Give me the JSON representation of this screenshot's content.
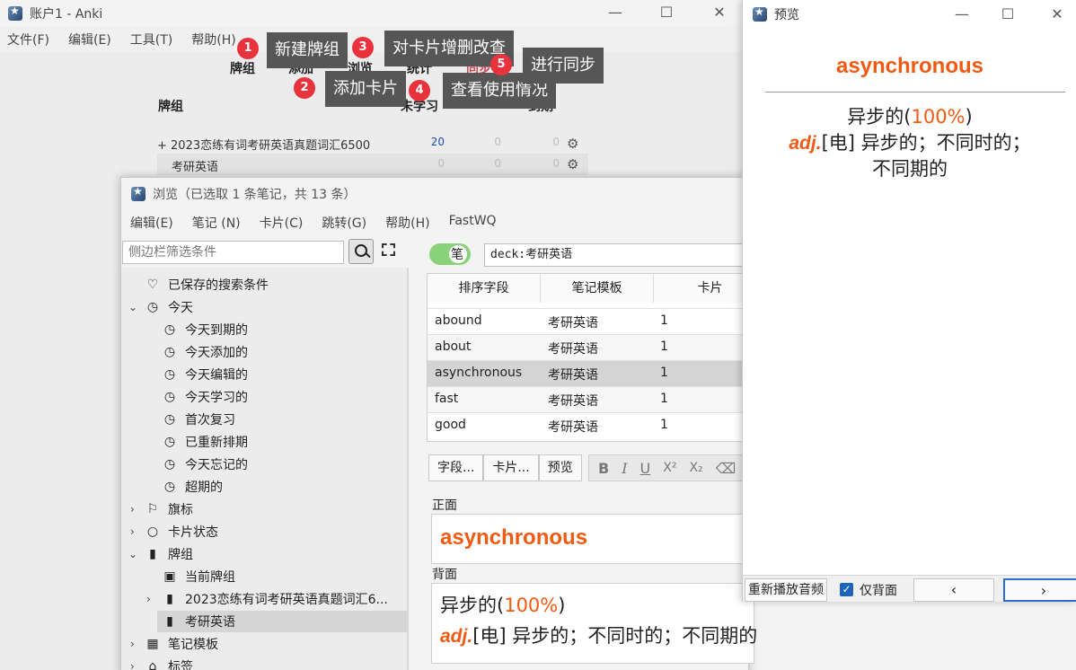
{
  "main": {
    "title": "账户1 - Anki",
    "menu": [
      "文件(F)",
      "编辑(E)",
      "工具(T)",
      "帮助(H)"
    ],
    "toolbar": {
      "decks": "牌组",
      "add": "添加",
      "browse": "浏览",
      "stats": "统计",
      "sync": "同步"
    },
    "deck_list": {
      "col_deck": "牌组",
      "col_new": "未学习",
      "col_due": "到期",
      "rows": [
        {
          "name": "+ 2023恋练有词考研英语真题词汇6500",
          "new": "20",
          "learn": "0",
          "due": "0"
        },
        {
          "name": "考研英语",
          "new": "0",
          "learn": "0",
          "due": "0"
        }
      ]
    }
  },
  "callouts": [
    {
      "num": "1",
      "text": "新建牌组"
    },
    {
      "num": "2",
      "text": "添加卡片"
    },
    {
      "num": "3",
      "text": "对卡片增删改查"
    },
    {
      "num": "4",
      "text": "查看使用情况"
    },
    {
      "num": "5",
      "text": "进行同步"
    }
  ],
  "browse": {
    "title": "浏览（已选取 1 条笔记，共 13 条）",
    "menu": [
      "编辑(E)",
      "笔记 (N)",
      "卡片(C)",
      "跳转(G)",
      "帮助(H)",
      "FastWQ"
    ],
    "sidebar_placeholder": "侧边栏筛选条件",
    "toggle_label": "笔",
    "query": "deck:考研英语",
    "tree": {
      "saved": "已保存的搜索条件",
      "today": "今天",
      "today_due": "今天到期的",
      "today_added": "今天添加的",
      "today_edited": "今天编辑的",
      "today_studied": "今天学习的",
      "first_review": "首次复习",
      "rescheduled": "已重新排期",
      "forgotten": "今天忘记的",
      "overdue": "超期的",
      "flags": "旗标",
      "card_state": "卡片状态",
      "decks": "牌组",
      "current_deck": "当前牌组",
      "deck_long": "2023恋练有词考研英语真题词汇6...",
      "deck_kaoyan": "考研英语",
      "note_types": "笔记模板",
      "tags": "标签"
    },
    "table": {
      "headers": [
        "排序字段",
        "笔记模板",
        "卡片"
      ],
      "rows": [
        {
          "sort": "abound",
          "type": "考研英语",
          "card": "1"
        },
        {
          "sort": "about",
          "type": "考研英语",
          "card": "1"
        },
        {
          "sort": "asynchronous",
          "type": "考研英语",
          "card": "1"
        },
        {
          "sort": "fast",
          "type": "考研英语",
          "card": "1"
        },
        {
          "sort": "good",
          "type": "考研英语",
          "card": "1"
        }
      ]
    },
    "editor": {
      "fields_btn": "字段...",
      "cards_btn": "卡片...",
      "preview_btn": "预览",
      "front_label": "正面",
      "back_label": "背面",
      "front_value": "asynchronous",
      "back_line1_a": "异步的(",
      "back_line1_pct": "100%",
      "back_line1_b": ")",
      "back_adj": "adj.",
      "back_line2": "[电] 异步的；不同时的；不同期的"
    }
  },
  "preview": {
    "title": "预览",
    "word": "asynchronous",
    "line1_a": "异步的(",
    "line1_pct": "100%",
    "line1_b": ")",
    "adj": "adj.",
    "line2": "[电] 异步的；不同时的；",
    "line3": "不同期的",
    "replay": "重新播放音频",
    "back_only": "仅背面",
    "prev": "‹",
    "next": "›"
  }
}
